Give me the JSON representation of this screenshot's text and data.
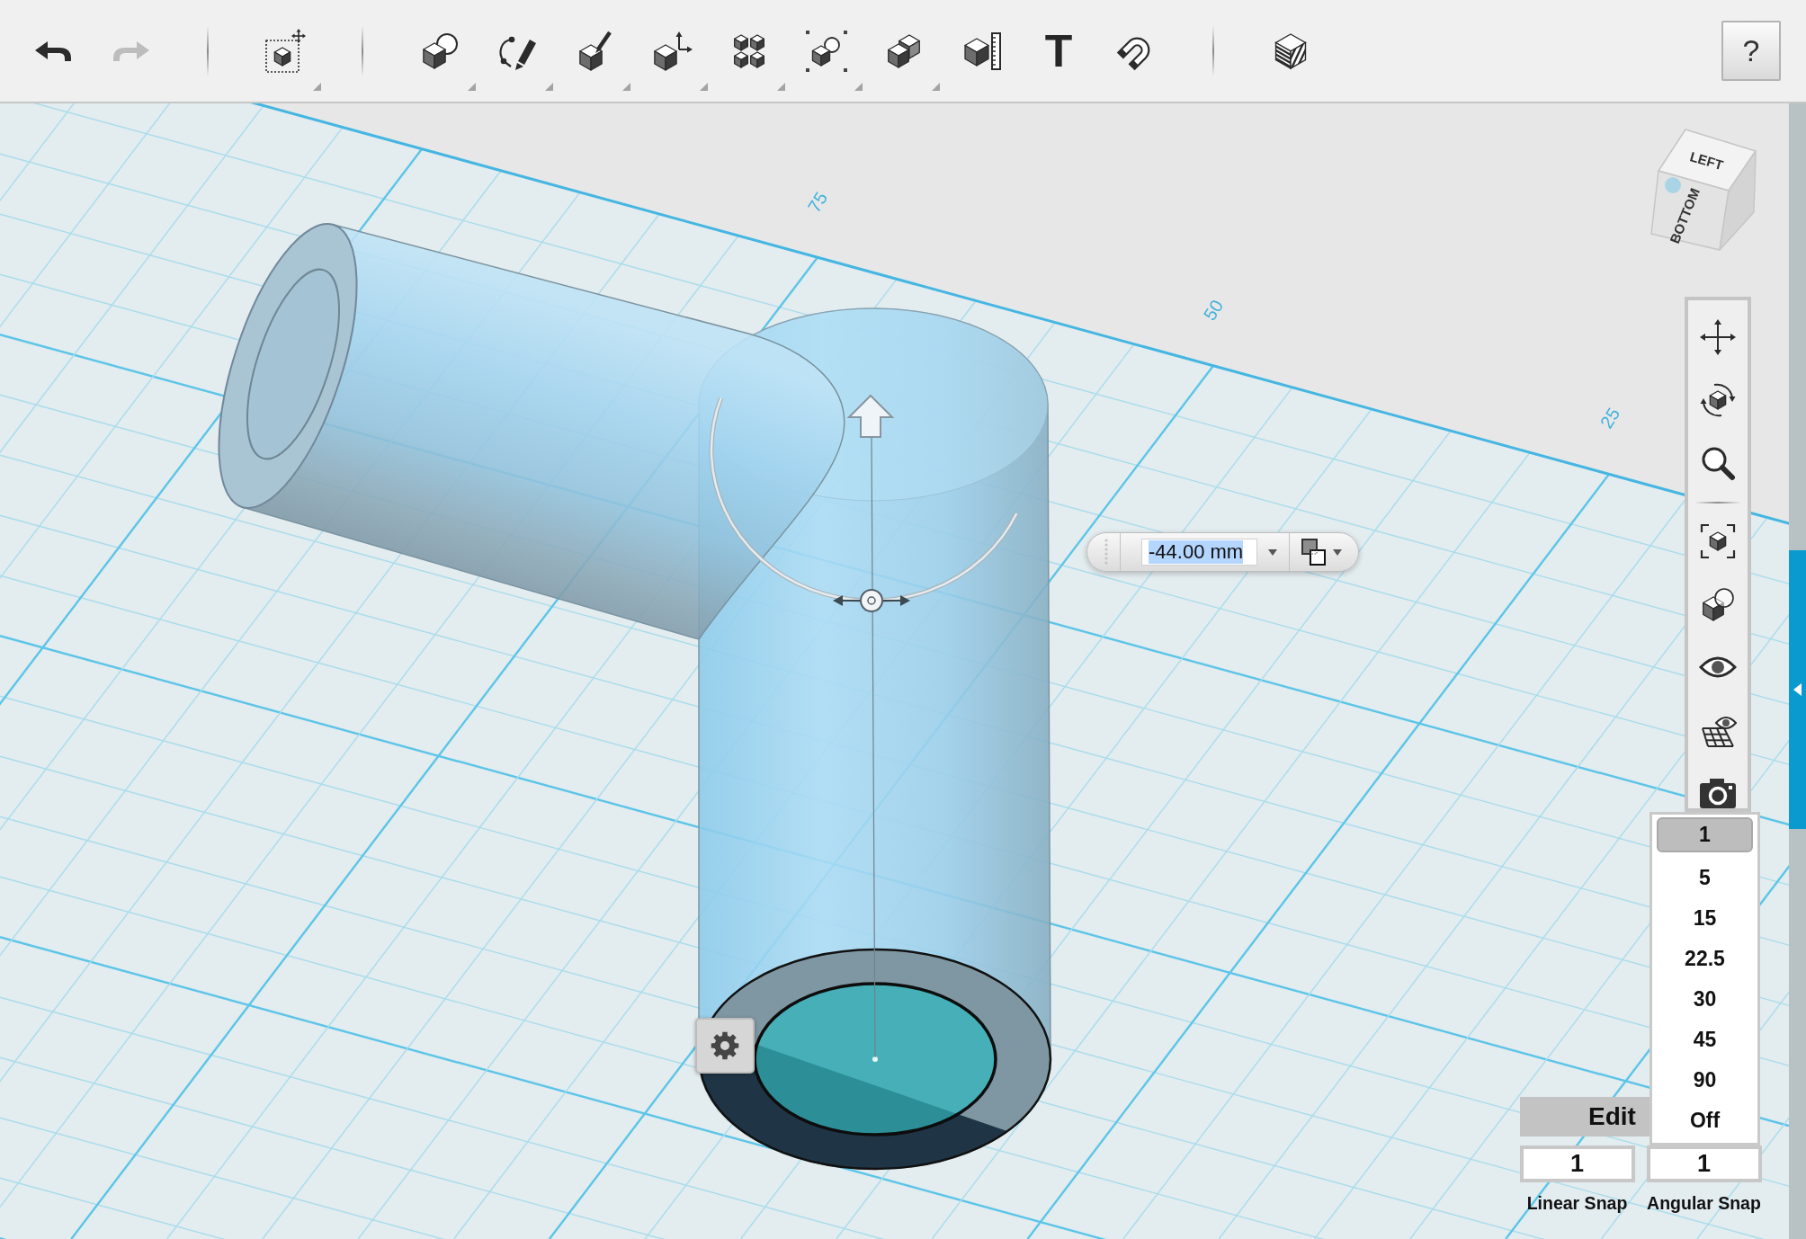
{
  "toolbar": {
    "tools": [
      {
        "kind": "undo",
        "disabled": false
      },
      {
        "kind": "redo",
        "disabled": true
      },
      {
        "kind": "separator"
      },
      {
        "kind": "transform",
        "submenu": true
      },
      {
        "kind": "separator"
      },
      {
        "kind": "primitives",
        "submenu": true
      },
      {
        "kind": "sketch",
        "submenu": true
      },
      {
        "kind": "construct",
        "submenu": true
      },
      {
        "kind": "modify",
        "submenu": true
      },
      {
        "kind": "pattern",
        "submenu": true
      },
      {
        "kind": "group",
        "submenu": true
      },
      {
        "kind": "combine",
        "submenu": true
      },
      {
        "kind": "measure"
      },
      {
        "kind": "text",
        "label": "T"
      },
      {
        "kind": "snap"
      },
      {
        "kind": "separator"
      },
      {
        "kind": "material"
      }
    ],
    "help": "?"
  },
  "viewport": {
    "grid_labels": [
      "75",
      "50",
      "25"
    ]
  },
  "view_cube": {
    "faces": [
      "LEFT",
      "BOTTOM"
    ]
  },
  "navigation": [
    {
      "kind": "pan"
    },
    {
      "kind": "orbit"
    },
    {
      "kind": "zoom"
    },
    {
      "kind": "separator"
    },
    {
      "kind": "fit"
    },
    {
      "kind": "zoom_selected"
    },
    {
      "kind": "visibility"
    },
    {
      "kind": "grid_visibility"
    },
    {
      "kind": "camera"
    }
  ],
  "value_popup": {
    "value": "-44.00 mm",
    "highlighted": true
  },
  "angular_snap_menu": {
    "options": [
      {
        "label": "1",
        "selected": true
      },
      {
        "label": "5",
        "selected": false
      },
      {
        "label": "15",
        "selected": false
      },
      {
        "label": "22.5",
        "selected": false
      },
      {
        "label": "30",
        "selected": false
      },
      {
        "label": "45",
        "selected": false
      },
      {
        "label": "90",
        "selected": false
      },
      {
        "label": "Off",
        "selected": false
      }
    ]
  },
  "edit_grid_button": {
    "label": "Edit"
  },
  "snap_fields": [
    {
      "value": "1",
      "label": "Linear Snap"
    },
    {
      "value": "1",
      "label": "Angular Snap"
    }
  ]
}
